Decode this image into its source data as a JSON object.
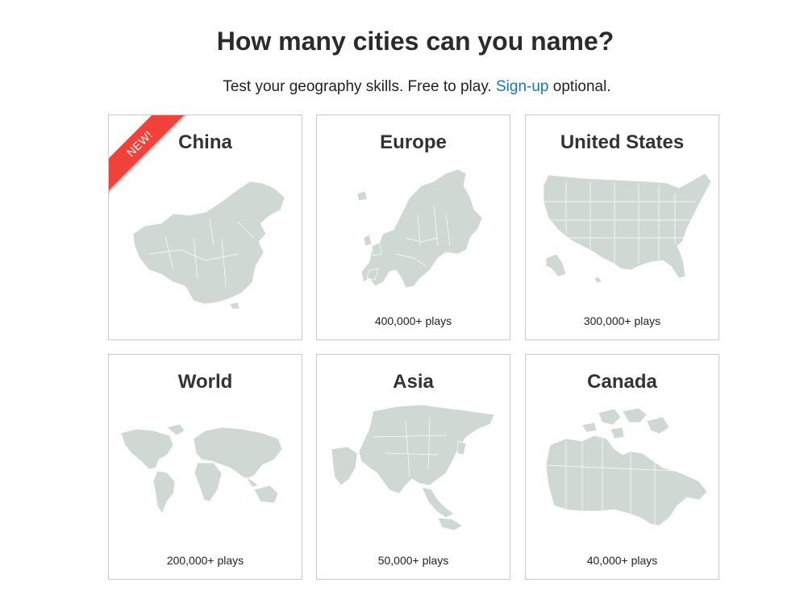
{
  "header": {
    "title": "How many cities can you name?",
    "subtitle_prefix": "Test your geography skills. Free to play. ",
    "signup_link": "Sign-up",
    "subtitle_suffix": " optional."
  },
  "cards": [
    {
      "title": "China",
      "plays": "",
      "badge": "NEW!"
    },
    {
      "title": "Europe",
      "plays": "400,000+ plays"
    },
    {
      "title": "United States",
      "plays": "300,000+ plays"
    },
    {
      "title": "World",
      "plays": "200,000+ plays"
    },
    {
      "title": "Asia",
      "plays": "50,000+ plays"
    },
    {
      "title": "Canada",
      "plays": "40,000+ plays"
    }
  ],
  "colors": {
    "map_fill": "#cfd8d2",
    "ribbon": "#f2403a",
    "link": "#1a73c8"
  }
}
